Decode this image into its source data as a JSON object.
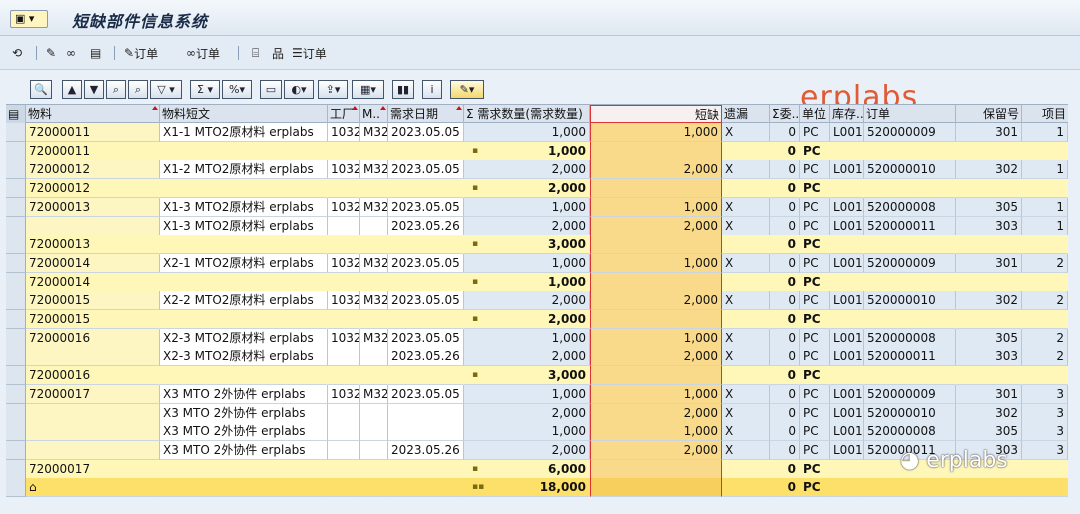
{
  "title": "短缺部件信息系统",
  "appbar": {
    "order_btn1": "订单",
    "order_btn2": "订单",
    "order_btn3": "订单"
  },
  "watermark_top": "erplabs",
  "watermark_bottom": "erplabs",
  "columns": {
    "material": "物料",
    "desc": "物料短文",
    "plant": "工厂",
    "mrp": "M..",
    "reqdate": "需求日期",
    "reqqty": "Σ 需求数量(需求数量)",
    "short": "短缺",
    "missing": "遗漏",
    "sigma": "Σ委..",
    "unit": "单位",
    "stor": "库存..",
    "order": "订单",
    "resv": "保留号",
    "item": "项目"
  },
  "rows": [
    {
      "type": "data",
      "material": "72000011",
      "desc": "X1-1 MTO2原材料 erplabs",
      "plant": "1032",
      "mrp": "M32",
      "date": "2023.05.05",
      "qty": "1,000",
      "short": "1,000",
      "miss": "X",
      "sig": "0",
      "unit": "PC",
      "sloc": "L001",
      "order": "520000009",
      "resv": "301",
      "item": "1"
    },
    {
      "type": "sub",
      "material": "72000011",
      "qty": "1,000",
      "sig": "0",
      "unit": "PC"
    },
    {
      "type": "data",
      "material": "72000012",
      "desc": "X1-2 MTO2原材料 erplabs",
      "plant": "1032",
      "mrp": "M32",
      "date": "2023.05.05",
      "qty": "2,000",
      "short": "2,000",
      "miss": "X",
      "sig": "0",
      "unit": "PC",
      "sloc": "L001",
      "order": "520000010",
      "resv": "302",
      "item": "1"
    },
    {
      "type": "sub",
      "material": "72000012",
      "qty": "2,000",
      "sig": "0",
      "unit": "PC"
    },
    {
      "type": "data",
      "material": "72000013",
      "desc": "X1-3 MTO2原材料 erplabs",
      "plant": "1032",
      "mrp": "M32",
      "date": "2023.05.05",
      "qty": "1,000",
      "short": "1,000",
      "miss": "X",
      "sig": "0",
      "unit": "PC",
      "sloc": "L001",
      "order": "520000008",
      "resv": "305",
      "item": "1"
    },
    {
      "type": "data",
      "material": "",
      "desc": "X1-3 MTO2原材料 erplabs",
      "plant": "",
      "mrp": "",
      "date": "2023.05.26",
      "qty": "2,000",
      "short": "2,000",
      "miss": "X",
      "sig": "0",
      "unit": "PC",
      "sloc": "L001",
      "order": "520000011",
      "resv": "303",
      "item": "1"
    },
    {
      "type": "sub",
      "material": "72000013",
      "qty": "3,000",
      "sig": "0",
      "unit": "PC"
    },
    {
      "type": "data",
      "material": "72000014",
      "desc": "X2-1 MTO2原材料 erplabs",
      "plant": "1032",
      "mrp": "M32",
      "date": "2023.05.05",
      "qty": "1,000",
      "short": "1,000",
      "miss": "X",
      "sig": "0",
      "unit": "PC",
      "sloc": "L001",
      "order": "520000009",
      "resv": "301",
      "item": "2"
    },
    {
      "type": "sub",
      "material": "72000014",
      "qty": "1,000",
      "sig": "0",
      "unit": "PC"
    },
    {
      "type": "data",
      "material": "72000015",
      "desc": "X2-2 MTO2原材料 erplabs",
      "plant": "1032",
      "mrp": "M32",
      "date": "2023.05.05",
      "qty": "2,000",
      "short": "2,000",
      "miss": "X",
      "sig": "0",
      "unit": "PC",
      "sloc": "L001",
      "order": "520000010",
      "resv": "302",
      "item": "2"
    },
    {
      "type": "sub",
      "material": "72000015",
      "qty": "2,000",
      "sig": "0",
      "unit": "PC"
    },
    {
      "type": "data",
      "material": "72000016",
      "desc": "X2-3 MTO2原材料 erplabs",
      "plant": "1032",
      "mrp": "M32",
      "date": "2023.05.05",
      "qty": "1,000",
      "short": "1,000",
      "miss": "X",
      "sig": "0",
      "unit": "PC",
      "sloc": "L001",
      "order": "520000008",
      "resv": "305",
      "item": "2"
    },
    {
      "type": "data",
      "material": "",
      "desc": "X2-3 MTO2原材料 erplabs",
      "plant": "",
      "mrp": "",
      "date": "2023.05.26",
      "qty": "2,000",
      "short": "2,000",
      "miss": "X",
      "sig": "0",
      "unit": "PC",
      "sloc": "L001",
      "order": "520000011",
      "resv": "303",
      "item": "2"
    },
    {
      "type": "sub",
      "material": "72000016",
      "qty": "3,000",
      "sig": "0",
      "unit": "PC"
    },
    {
      "type": "data",
      "material": "72000017",
      "desc": "X3 MTO 2外协件 erplabs",
      "plant": "1032",
      "mrp": "M32",
      "date": "2023.05.05",
      "qty": "1,000",
      "short": "1,000",
      "miss": "X",
      "sig": "0",
      "unit": "PC",
      "sloc": "L001",
      "order": "520000009",
      "resv": "301",
      "item": "3"
    },
    {
      "type": "data",
      "material": "",
      "desc": "X3 MTO 2外协件 erplabs",
      "plant": "",
      "mrp": "",
      "date": "",
      "qty": "2,000",
      "short": "2,000",
      "miss": "X",
      "sig": "0",
      "unit": "PC",
      "sloc": "L001",
      "order": "520000010",
      "resv": "302",
      "item": "3"
    },
    {
      "type": "data",
      "material": "",
      "desc": "X3 MTO 2外协件 erplabs",
      "plant": "",
      "mrp": "",
      "date": "",
      "qty": "1,000",
      "short": "1,000",
      "miss": "X",
      "sig": "0",
      "unit": "PC",
      "sloc": "L001",
      "order": "520000008",
      "resv": "305",
      "item": "3"
    },
    {
      "type": "data",
      "material": "",
      "desc": "X3 MTO 2外协件 erplabs",
      "plant": "",
      "mrp": "",
      "date": "2023.05.26",
      "qty": "2,000",
      "short": "2,000",
      "miss": "X",
      "sig": "0",
      "unit": "PC",
      "sloc": "L001",
      "order": "520000011",
      "resv": "303",
      "item": "3"
    },
    {
      "type": "sub",
      "material": "72000017",
      "qty": "6,000",
      "sig": "0",
      "unit": "PC"
    },
    {
      "type": "total",
      "qty": "18,000",
      "sig": "0",
      "unit": "PC"
    }
  ]
}
